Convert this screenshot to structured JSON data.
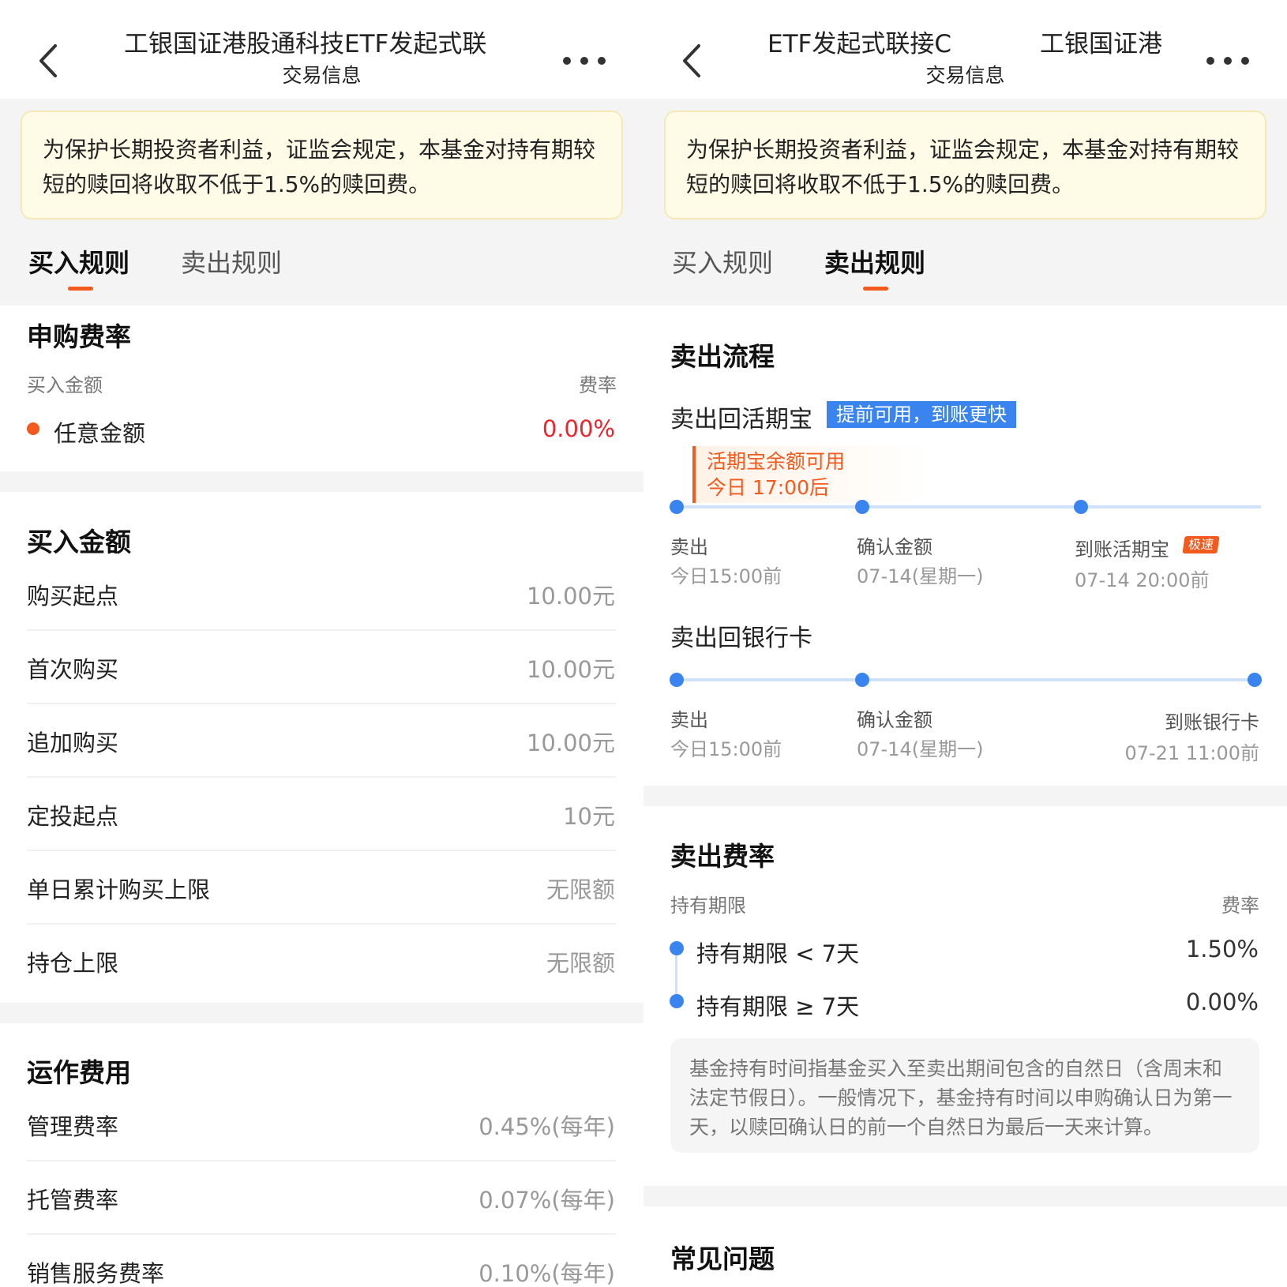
{
  "left": {
    "title": "工银国证港股通科技ETF发起式联",
    "subtitle": "交易信息",
    "notice": "为保护长期投资者利益，证监会规定，本基金对持有期较短的赎回将收取不低于1.5%的赎回费。",
    "tabs": [
      "买入规则",
      "卖出规则"
    ],
    "fee_section": {
      "title": "申购费率",
      "col_amount": "买入金额",
      "col_rate": "费率",
      "row_label": "任意金额",
      "row_rate": "0.00%"
    },
    "amount_section": {
      "title": "买入金额",
      "rows": [
        {
          "label": "购买起点",
          "value": "10.00元"
        },
        {
          "label": "首次购买",
          "value": "10.00元"
        },
        {
          "label": "追加购买",
          "value": "10.00元"
        },
        {
          "label": "定投起点",
          "value": "10元"
        },
        {
          "label": "单日累计购买上限",
          "value": "无限额"
        },
        {
          "label": "持仓上限",
          "value": "无限额"
        }
      ]
    },
    "ops_section": {
      "title": "运作费用",
      "rows": [
        {
          "label": "管理费率",
          "value": "0.45%(每年)"
        },
        {
          "label": "托管费率",
          "value": "0.07%(每年)"
        },
        {
          "label": "销售服务费率",
          "value": "0.10%(每年)"
        }
      ]
    }
  },
  "right": {
    "title_a": "ETF发起式联接C",
    "title_b": "工银国证港",
    "subtitle": "交易信息",
    "notice": "为保护长期投资者利益，证监会规定，本基金对持有期较短的赎回将收取不低于1.5%的赎回费。",
    "tabs": [
      "买入规则",
      "卖出规则"
    ],
    "flow": {
      "title": "卖出流程",
      "route1": {
        "label": "卖出回活期宝",
        "badge": "提前可用，到账更快",
        "tip_line1": "活期宝余额可用",
        "tip_line2": "今日 17:00后",
        "steps": [
          {
            "label": "卖出",
            "time": "今日15:00前"
          },
          {
            "label": "确认金额",
            "time": "07-14(星期一)"
          },
          {
            "label": "到账活期宝",
            "badge": "极速",
            "time": "07-14 20:00前"
          }
        ]
      },
      "route2": {
        "label": "卖出回银行卡",
        "steps": [
          {
            "label": "卖出",
            "time": "今日15:00前"
          },
          {
            "label": "确认金额",
            "time": "07-14(星期一)"
          },
          {
            "label": "到账银行卡",
            "time": "07-21 11:00前"
          }
        ]
      }
    },
    "fee": {
      "title": "卖出费率",
      "col_period": "持有期限",
      "col_rate": "费率",
      "rows": [
        {
          "label": "持有期限 < 7天",
          "rate": "1.50%"
        },
        {
          "label": "持有期限 ≥ 7天",
          "rate": "0.00%"
        }
      ],
      "note": "基金持有时间指基金买入至卖出期间包含的自然日（含周末和法定节假日）。一般情况下，基金持有时间以申购确认日为第一天，以赎回确认日的前一个自然日为最后一天来计算。"
    },
    "faq_title": "常见问题"
  },
  "colors": {
    "accent": "#f25a1e",
    "blue": "#3a84f0",
    "rate_red": "#e8262d"
  },
  "icons": {
    "back": "chevron-left-icon",
    "more": "more-dots-icon"
  }
}
